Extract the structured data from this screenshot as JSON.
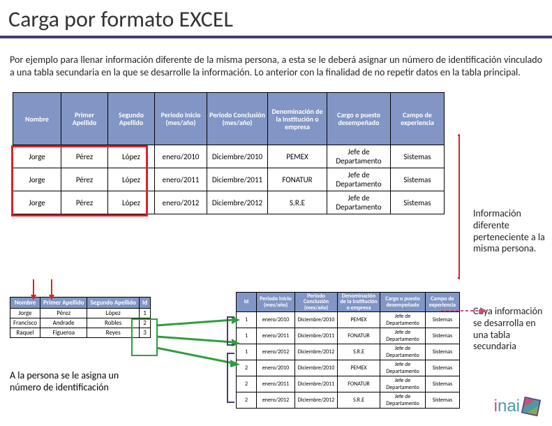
{
  "title": "Carga por formato EXCEL",
  "description": "Por ejemplo para llenar información diferente de la misma persona, a esta se le deberá asignar un número de identificación vinculado a una tabla secundaria en la que se desarrolle la información. Lo anterior con la finalidad de no repetir datos en la tabla principal.",
  "main_table": {
    "headers": [
      "Nombre",
      "Primer Apellido",
      "Segundo Apellido",
      "Periodo Inicio (mes/año)",
      "Periodo Conclusión (mes/año)",
      "Denominación de la Institución o empresa",
      "Cargo o puesto desempeñado",
      "Campo de experiencia"
    ],
    "rows": [
      [
        "Jorge",
        "Pérez",
        "López",
        "enero/2010",
        "Diciembre/2010",
        "PEMEX",
        "Jefe de Departamento",
        "Sistemas"
      ],
      [
        "Jorge",
        "Pérez",
        "López",
        "enero/2011",
        "Diciembre/2011",
        "FONATUR",
        "Jefe de Departamento",
        "Sistemas"
      ],
      [
        "Jorge",
        "Pérez",
        "López",
        "enero/2012",
        "Diciembre/2012",
        "S.R.E",
        "Jefe de Departamento",
        "Sistemas"
      ]
    ]
  },
  "note_right_1": "Información diferente perteneciente a la misma persona.",
  "note_right_2": "Cuya información se desarrolla en una tabla secundaria",
  "small_table": {
    "headers": [
      "Nombre",
      "Primer Apellido",
      "Segundo Apellido",
      "Id"
    ],
    "rows": [
      [
        "Jorge",
        "Pérez",
        "López",
        "1"
      ],
      [
        "Francisco",
        "Andrade",
        "Robles",
        "2"
      ],
      [
        "Raquel",
        "Figueroa",
        "Reyes",
        "3"
      ]
    ]
  },
  "lower_caption": "A la persona se le asigna un número de identificación",
  "sec_table": {
    "headers": [
      "Id",
      "Periodo Inicio (mes/año)",
      "Periodo Conclusión (mes/año)",
      "Denominación de la Institución o empresa",
      "Cargo o puesto desempeñado",
      "Campo de experiencia"
    ],
    "rows": [
      [
        "1",
        "enero/2010",
        "Diciembre/2010",
        "PEMEX",
        "Jefe de Departamento",
        "Sistemas"
      ],
      [
        "1",
        "enero/2011",
        "Diciembre/2011",
        "FONATUR",
        "Jefe de Departamento",
        "Sistemas"
      ],
      [
        "1",
        "enero/2012",
        "Diciembre/2012",
        "S.R.E",
        "Jefe de Departamento",
        "Sistemas"
      ],
      [
        "2",
        "enero/2010",
        "Diciembre/2010",
        "PEMEX",
        "Jefe de Departamento",
        "Sistemas"
      ],
      [
        "2",
        "enero/2011",
        "Diciembre/2011",
        "FONATUR",
        "Jefe de Departamento",
        "Sistemas"
      ],
      [
        "2",
        "enero/2012",
        "Diciembre/2012",
        "S.R.E",
        "Jefe de Departamento",
        "Sistemas"
      ]
    ]
  },
  "logo_text": "inai"
}
